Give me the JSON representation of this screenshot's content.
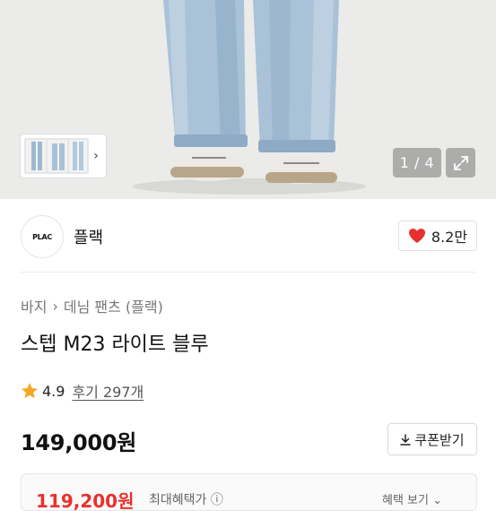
{
  "gallery": {
    "counter": "1 / 4",
    "thumb_next_glyph": "›",
    "expand_icon": "expand-icon"
  },
  "brand": {
    "logo_text": "PLAC",
    "name": "플랙",
    "likes": "8.2만",
    "heart_color": "#e8312f"
  },
  "product": {
    "breadcrumb": [
      "바지",
      "데님 팬츠 (플랙)"
    ],
    "breadcrumb_separator": "›",
    "title": "스텝 M23 라이트 블루",
    "rating": "4.9",
    "reviews": "후기 297개",
    "price": "149,000원",
    "coupon_label": "쿠폰받기",
    "star_color": "#f5a623"
  },
  "bottom_card": {
    "sale_price": "119,200원",
    "note": "최대혜택가 ⓘ",
    "more": "혜택 보기 ⌄",
    "accent": "#e8312f"
  }
}
